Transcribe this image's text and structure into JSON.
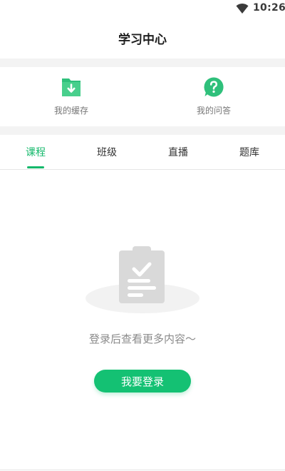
{
  "status_bar": {
    "time": "10:26",
    "wifi_icon": "wifi-icon"
  },
  "header": {
    "title": "学习中心"
  },
  "shortcuts": [
    {
      "label": "我的缓存",
      "icon": "download-folder-icon",
      "color": "#2fc07b"
    },
    {
      "label": "我的问答",
      "icon": "question-bubble-icon",
      "color": "#2fc07b"
    }
  ],
  "tabs": [
    {
      "label": "课程",
      "active": true
    },
    {
      "label": "班级",
      "active": false
    },
    {
      "label": "直播",
      "active": false
    },
    {
      "label": "题库",
      "active": false
    }
  ],
  "empty_state": {
    "icon": "clipboard-check-icon",
    "message": "登录后查看更多内容～",
    "button_label": "我要登录"
  },
  "colors": {
    "accent": "#14b86b",
    "button": "#14c173",
    "divider": "#f3f3f3"
  }
}
